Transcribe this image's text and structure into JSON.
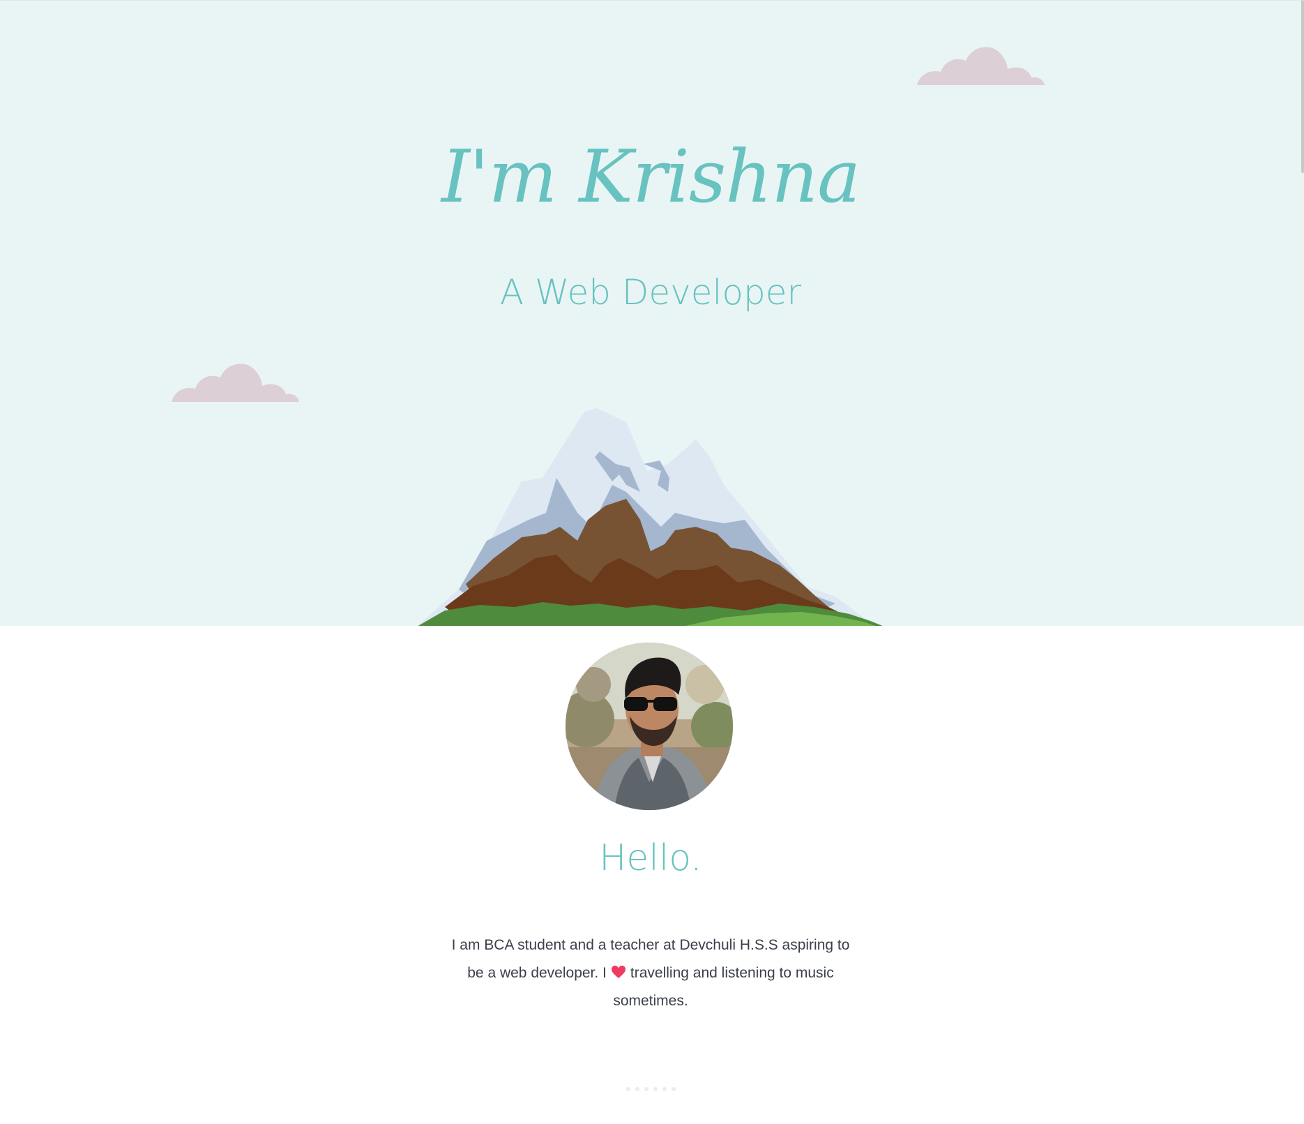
{
  "hero": {
    "title": "I'm Krishna",
    "subtitle": "A Web Developer"
  },
  "about": {
    "heading": "Hello.",
    "bio_part1": "I am BCA student and a teacher at Devchuli H.S.S aspiring to be a web developer. I",
    "bio_icon": "heart-icon",
    "bio_part2": "travelling and listening to music sometimes."
  },
  "colors": {
    "accent": "#68c2c0",
    "hero_bg": "#e9f5f5",
    "cloud": "#dccfd5",
    "text": "#3a3f4a",
    "heart": "#ef3b5f"
  },
  "icons": {
    "clouds": "cloud-icon",
    "mountain": "mountain-illustration",
    "avatar": "profile-photo"
  }
}
